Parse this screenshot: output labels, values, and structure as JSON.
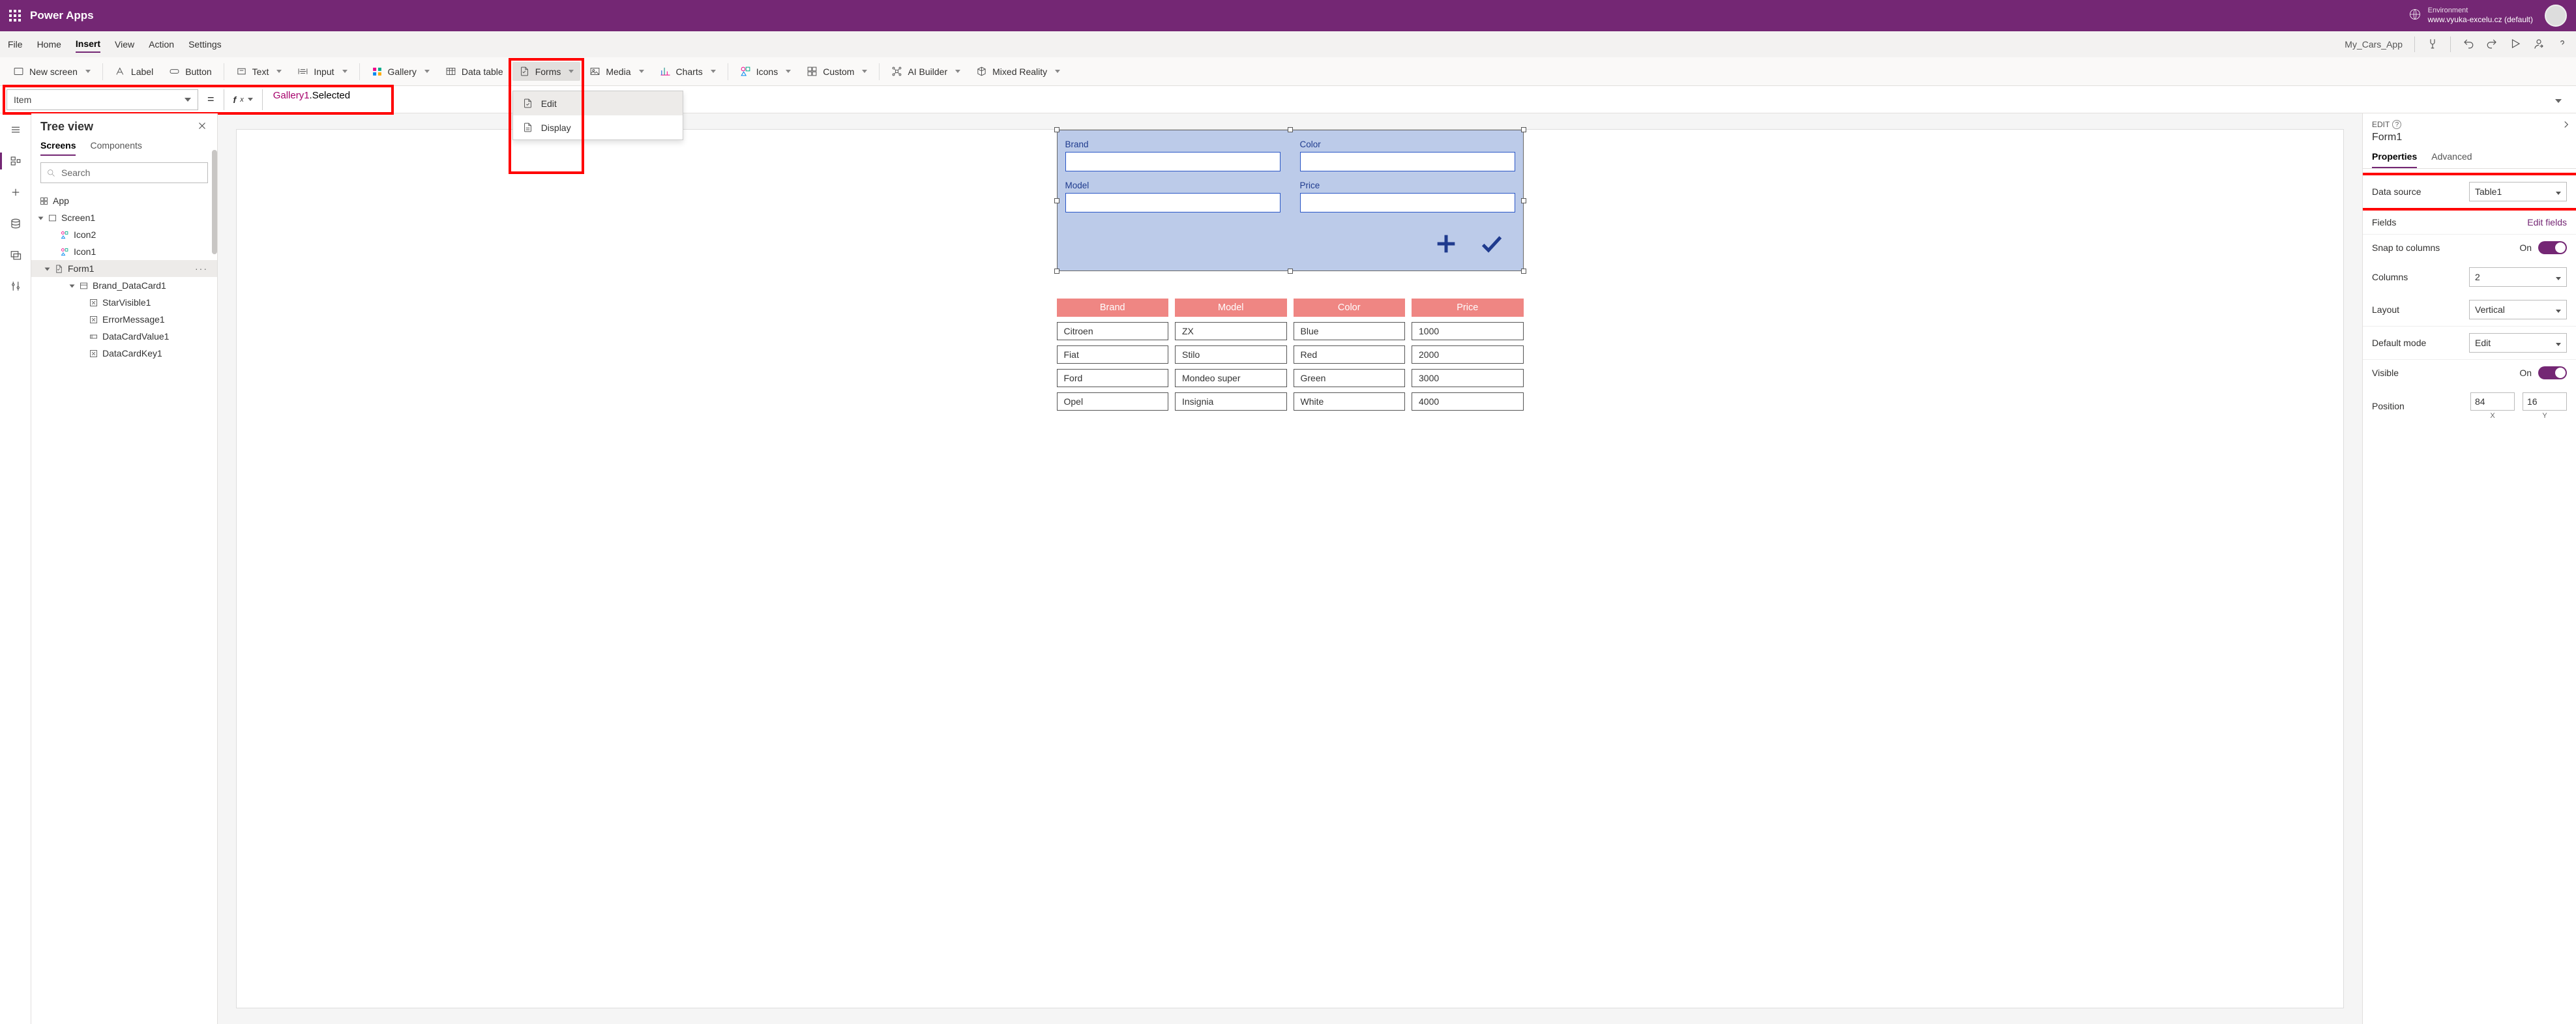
{
  "titlebar": {
    "app": "Power Apps",
    "env_label": "Environment",
    "env_name": "www.vyuka-excelu.cz (default)"
  },
  "menubar": {
    "items": [
      "File",
      "Home",
      "Insert",
      "View",
      "Action",
      "Settings"
    ],
    "active": "Insert",
    "appname": "My_Cars_App"
  },
  "ribbon": {
    "newscreen": "New screen",
    "label": "Label",
    "button": "Button",
    "text": "Text",
    "input": "Input",
    "gallery": "Gallery",
    "datatable": "Data table",
    "forms": "Forms",
    "media": "Media",
    "charts": "Charts",
    "icons": "Icons",
    "custom": "Custom",
    "aibuilder": "AI Builder",
    "mixedreality": "Mixed Reality",
    "forms_menu": {
      "edit": "Edit",
      "display": "Display"
    }
  },
  "formulabar": {
    "property": "Item",
    "formula_ident": "Gallery1",
    "formula_prop": ".Selected"
  },
  "treeview": {
    "title": "Tree view",
    "tabs": {
      "screens": "Screens",
      "components": "Components"
    },
    "search": "Search",
    "app": "App",
    "screen": "Screen1",
    "icon2": "Icon2",
    "icon1": "Icon1",
    "form1": "Form1",
    "branddc": "Brand_DataCard1",
    "starvis": "StarVisible1",
    "errmsg": "ErrorMessage1",
    "dcval": "DataCardValue1",
    "dckey": "DataCardKey1"
  },
  "canvas": {
    "form": {
      "brand": "Brand",
      "model": "Model",
      "color": "Color",
      "price": "Price"
    },
    "headers": [
      "Brand",
      "Model",
      "Color",
      "Price"
    ],
    "rows": [
      [
        "Citroen",
        "ZX",
        "Blue",
        "1000"
      ],
      [
        "Fiat",
        "Stilo",
        "Red",
        "2000"
      ],
      [
        "Ford",
        "Mondeo super",
        "Green",
        "3000"
      ],
      [
        "Opel",
        "Insignia",
        "White",
        "4000"
      ]
    ]
  },
  "properties": {
    "mode": "EDIT",
    "name": "Form1",
    "tabs": {
      "properties": "Properties",
      "advanced": "Advanced"
    },
    "datasource_lbl": "Data source",
    "datasource_val": "Table1",
    "fields_lbl": "Fields",
    "editfields": "Edit fields",
    "snap_lbl": "Snap to columns",
    "snap_val": "On",
    "columns_lbl": "Columns",
    "columns_val": "2",
    "layout_lbl": "Layout",
    "layout_val": "Vertical",
    "defmode_lbl": "Default mode",
    "defmode_val": "Edit",
    "visible_lbl": "Visible",
    "visible_val": "On",
    "position_lbl": "Position",
    "position_x": "84",
    "position_y": "16",
    "xlabel": "X",
    "ylabel": "Y"
  }
}
